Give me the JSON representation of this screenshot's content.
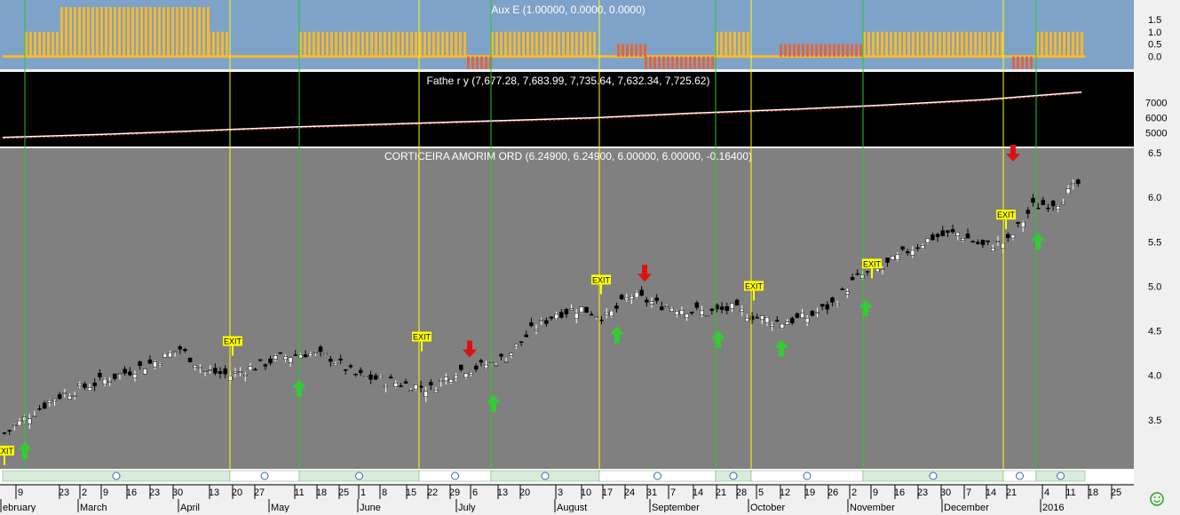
{
  "panels": {
    "aux": {
      "title": "Aux E (1.00000, 0.0000, 0.0000)",
      "y_ticks": [
        "1.5",
        "1.0",
        "0.5",
        "0.0"
      ],
      "ylim": [
        -0.3,
        2.0
      ],
      "bg": "#7fa2c9"
    },
    "father": {
      "title": "Fathe r y (7,677.28, 7,683.99, 7,735.64, 7,632.34, 7,725.62)",
      "y_ticks": [
        "7000",
        "6000",
        "5000"
      ],
      "ylim": [
        4200,
        7900
      ],
      "bg": "#000000"
    },
    "main": {
      "title": "CORTICEIRA AMORIM ORD (6.24900, 6.24900, 6.00000, 6.00000, -0.16400)",
      "y_ticks": [
        "6.5",
        "6.0",
        "5.5",
        "5.0",
        "4.5",
        "4.0",
        "3.5"
      ],
      "ylim": [
        2.95,
        6.55
      ],
      "bg": "#808080"
    }
  },
  "x_axis": {
    "days": [
      "9",
      "23",
      "2",
      "9",
      "16",
      "23",
      "30",
      "13",
      "20",
      "27",
      "11",
      "18",
      "25",
      "1",
      "8",
      "15",
      "22",
      "29",
      "6",
      "13",
      "20",
      "3",
      "10",
      "17",
      "24",
      "31",
      "7",
      "14",
      "21",
      "28",
      "5",
      "12",
      "19",
      "26",
      "2",
      "9",
      "16",
      "23",
      "30",
      "7",
      "14",
      "21",
      "4",
      "11",
      "18",
      "25"
    ],
    "months": [
      "ebruary",
      "March",
      "April",
      "May",
      "June",
      "July",
      "August",
      "September",
      "October",
      "November",
      "December",
      "2016"
    ]
  },
  "labels": {
    "exit": "EXIT"
  },
  "icons": {
    "smiley": "smiley-icon",
    "arrow_up": "arrow-up-icon",
    "arrow_down": "arrow-down-icon"
  },
  "colors": {
    "buy": "#33cc33",
    "sell": "#dd1111",
    "exit": "#ffff00",
    "aux_bar": "#f5b82e",
    "aux_neg": "#e0663a"
  },
  "chart_data": [
    {
      "type": "bar",
      "title": "Aux E (1.00000, 0.0000, 0.0000)",
      "description_series": "indicator value per period",
      "segments": [
        {
          "from": "Feb 2015",
          "to": "Feb 2015",
          "value": 1.0
        },
        {
          "from": "Mar 2015",
          "to": "Apr 2015",
          "value": 2.0
        },
        {
          "from": "Apr 2015",
          "to": "Apr 2015",
          "value": 1.0
        },
        {
          "from": "May 2015",
          "to": "Jul 2015",
          "value": 1.0
        },
        {
          "from": "Jul 2015",
          "to": "Jul 2015",
          "value": -0.5
        },
        {
          "from": "Jul 2015",
          "to": "Aug 2015",
          "value": 1.0
        },
        {
          "from": "Aug 2015",
          "to": "Aug 2015",
          "value": 0.5
        },
        {
          "from": "Aug 2015",
          "to": "Sep 2015",
          "value": -0.5
        },
        {
          "from": "Sep 2015",
          "to": "Sep 2015",
          "value": 1.0
        },
        {
          "from": "Oct 2015",
          "to": "Nov 2015",
          "value": 0.5
        },
        {
          "from": "Nov 2015",
          "to": "Dec 2015",
          "value": 1.0
        },
        {
          "from": "Dec 2015",
          "to": "Dec 2015",
          "value": -0.5
        },
        {
          "from": "Dec 2015",
          "to": "Jan 2016",
          "value": 1.0
        }
      ],
      "ylim": [
        -0.3,
        2.0
      ]
    },
    {
      "type": "line",
      "title": "Fathe r y (7,677.28, 7,683.99, 7,735.64, 7,632.34, 7,725.62)",
      "x": [
        "Feb",
        "Mar",
        "Apr",
        "May",
        "Jun",
        "Jul",
        "Aug",
        "Sep",
        "Oct",
        "Nov",
        "Dec",
        "Jan"
      ],
      "series": [
        {
          "values": [
            4650,
            4850,
            5100,
            5350,
            5550,
            5750,
            5950,
            6250,
            6500,
            6800,
            7150,
            7650
          ]
        }
      ],
      "ylim": [
        4200,
        7900
      ]
    },
    {
      "type": "line",
      "title": "CORTICEIRA AMORIM ORD (6.24900, 6.24900, 6.00000, 6.00000, -0.16400)",
      "x": [
        "Feb 9",
        "Feb 23",
        "Mar 2",
        "Mar 9",
        "Mar 16",
        "Mar 23",
        "Mar 30",
        "Apr 13",
        "Apr 20",
        "Apr 27",
        "May 11",
        "May 18",
        "May 25",
        "Jun 1",
        "Jun 8",
        "Jun 15",
        "Jun 22",
        "Jun 29",
        "Jul 6",
        "Jul 13",
        "Jul 20",
        "Aug 3",
        "Aug 10",
        "Aug 17",
        "Aug 24",
        "Aug 31",
        "Sep 7",
        "Sep 14",
        "Sep 21",
        "Sep 28",
        "Oct 5",
        "Oct 12",
        "Oct 19",
        "Oct 26",
        "Nov 2",
        "Nov 9",
        "Nov 16",
        "Nov 23",
        "Nov 30",
        "Dec 7",
        "Dec 14",
        "Dec 21",
        "Jan 4",
        "Jan 11"
      ],
      "series": [
        {
          "values": [
            3.35,
            3.55,
            3.75,
            3.85,
            3.95,
            4.05,
            4.15,
            4.3,
            4.05,
            4.0,
            4.1,
            4.2,
            4.25,
            4.2,
            4.0,
            3.95,
            3.9,
            3.85,
            4.05,
            4.1,
            4.2,
            4.5,
            4.7,
            4.75,
            4.65,
            4.9,
            4.8,
            4.75,
            4.7,
            4.75,
            4.65,
            4.6,
            4.65,
            4.8,
            5.1,
            5.2,
            5.4,
            5.55,
            5.6,
            5.45,
            5.5,
            5.9,
            5.95,
            6.2
          ]
        }
      ],
      "ylim": [
        2.95,
        6.55
      ]
    }
  ]
}
